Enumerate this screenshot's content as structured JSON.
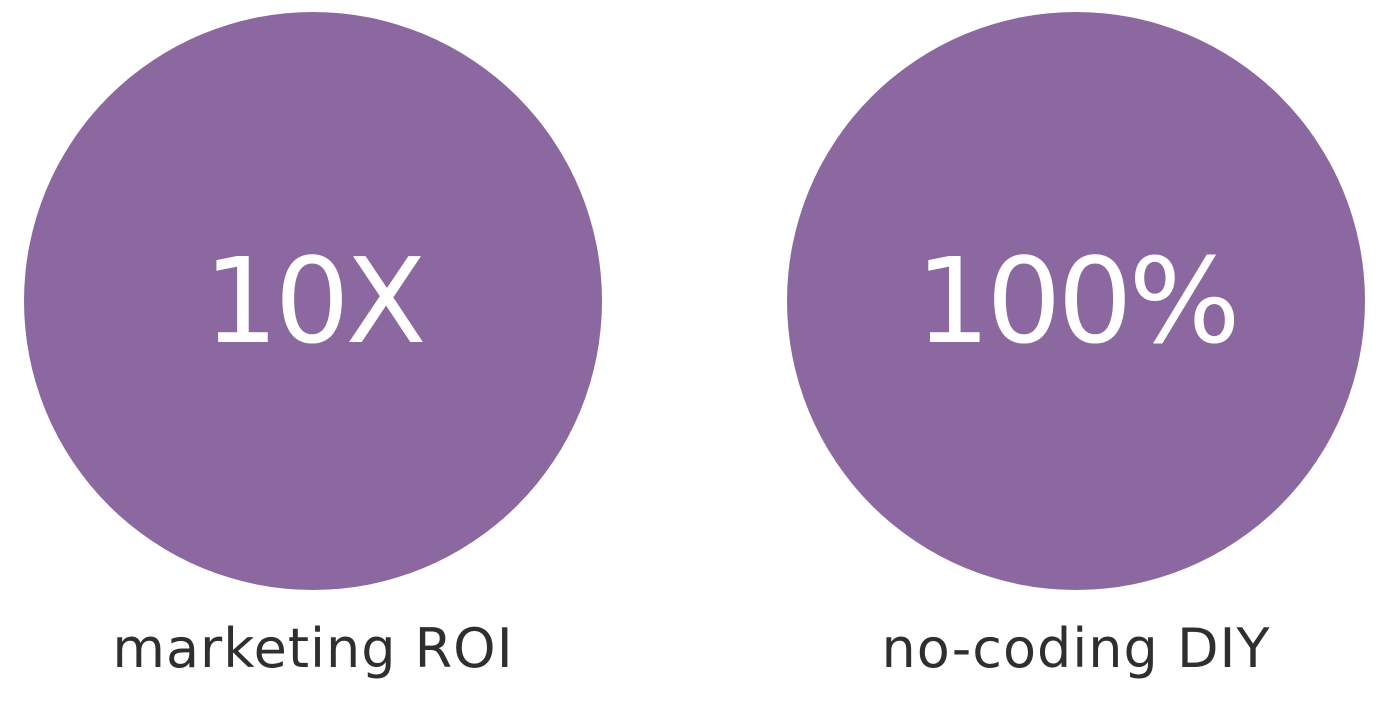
{
  "colors": {
    "circle": "#8B68A0",
    "value_text": "#FFFFFF",
    "caption_text": "#2F2F2F",
    "background": "#FFFFFF"
  },
  "stats": [
    {
      "value": "10X",
      "caption": "marketing ROI"
    },
    {
      "value": "100%",
      "caption": "no-coding DIY"
    }
  ]
}
